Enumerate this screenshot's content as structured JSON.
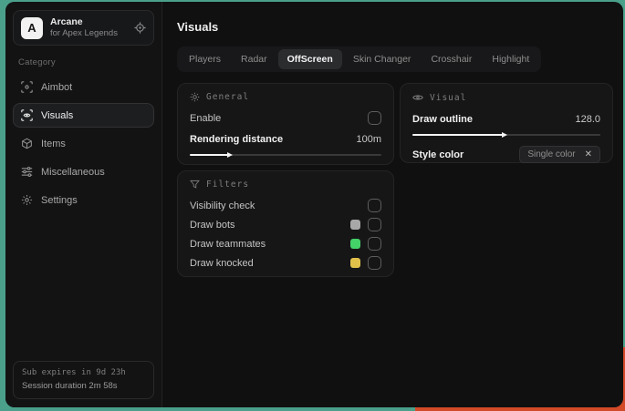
{
  "colors": {
    "backdrop_teal": "#4aa08b",
    "backdrop_orange": "#d34a28",
    "swatch_bots": "#a8a8a8",
    "swatch_teammates": "#43d168",
    "swatch_knocked": "#e2c14b"
  },
  "sidebar": {
    "app": {
      "logo_letter": "A",
      "name": "Arcane",
      "subtitle": "for Apex Legends"
    },
    "category_label": "Category",
    "items": [
      {
        "label": "Aimbot"
      },
      {
        "label": "Visuals",
        "active": true
      },
      {
        "label": "Items"
      },
      {
        "label": "Miscellaneous"
      },
      {
        "label": "Settings"
      }
    ],
    "footer": {
      "line1": "Sub expires in 9d 23h",
      "line2": "Session duration 2m 58s"
    }
  },
  "header": {
    "title": "Visuals"
  },
  "tabs": [
    {
      "label": "Players"
    },
    {
      "label": "Radar"
    },
    {
      "label": "OffScreen",
      "active": true
    },
    {
      "label": "Skin Changer"
    },
    {
      "label": "Crosshair"
    },
    {
      "label": "Highlight"
    }
  ],
  "panels": {
    "general": {
      "title": "General",
      "enable_label": "Enable",
      "enable_checked": false,
      "rendering_distance_label": "Rendering distance",
      "rendering_distance_value": "100m",
      "slider_percent": 20
    },
    "visual": {
      "title": "Visual",
      "draw_outline_label": "Draw outline",
      "draw_outline_value": "128.0",
      "slider_percent": 48,
      "style_color_label": "Style color",
      "style_color_value": "Single color",
      "style_color_clear": "✕"
    },
    "filters": {
      "title": "Filters",
      "rows": [
        {
          "label": "Visibility check",
          "checked": false
        },
        {
          "label": "Draw bots",
          "swatch": "#a8a8a8",
          "checked": false
        },
        {
          "label": "Draw teammates",
          "swatch": "#43d168",
          "checked": false
        },
        {
          "label": "Draw knocked",
          "swatch": "#e2c14b",
          "checked": false
        }
      ]
    }
  }
}
